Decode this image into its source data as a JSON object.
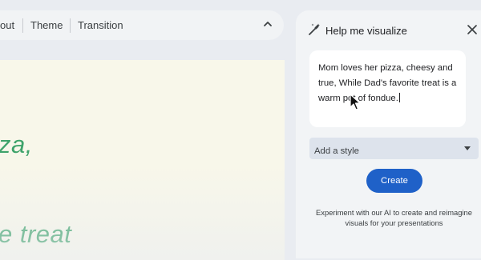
{
  "toolbar": {
    "items": [
      "out",
      "Theme",
      "Transition"
    ],
    "collapse_icon": "chevron-up-icon"
  },
  "slide": {
    "lines": [
      "za,",
      "e treat"
    ],
    "accent_color": "#3fa36b"
  },
  "panel": {
    "title": "Help me visualize",
    "title_icon": "magic-wand-icon",
    "close_icon": "close-icon",
    "prompt_text": "Mom loves her pizza, cheesy and true, While Dad's favorite treat is a warm pot of fondue.",
    "style_select_label": "Add a style",
    "create_button_label": "Create",
    "footnote": "Experiment with our AI to create and reimagine visuals for your presentations",
    "accent_color": "#1f61c8"
  }
}
